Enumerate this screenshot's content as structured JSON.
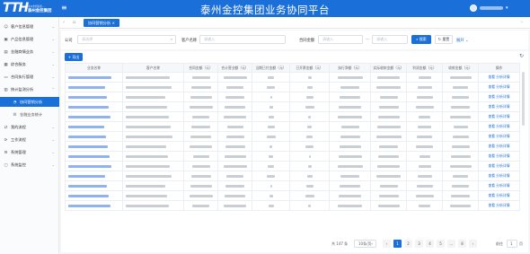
{
  "header": {
    "logo_mark": "TTH",
    "logo_line1": "泰州金控集团 …",
    "logo_line2": "泰州金控集团",
    "menu_icon": "menu-icon",
    "title": "泰州金控集团业务协同平台"
  },
  "sidebar": {
    "items": [
      {
        "label": "客户信息管理",
        "icon": "user-icon",
        "expandable": true
      },
      {
        "label": "产品信息管理",
        "icon": "box-icon",
        "expandable": true
      },
      {
        "label": "金融商情业务",
        "icon": "briefcase-icon",
        "expandable": true
      },
      {
        "label": "综合服务",
        "icon": "grid-icon",
        "expandable": true
      },
      {
        "label": "合同执行管理",
        "icon": "document-icon",
        "expandable": true
      },
      {
        "label": "统计监测分析",
        "icon": "chart-icon",
        "expandable": true
      },
      {
        "label": "协同营销分析",
        "icon": "pie-icon",
        "active": true
      },
      {
        "label": "金融业务统计",
        "icon": "list-icon"
      },
      {
        "label": "我的流程",
        "icon": "flow-icon",
        "expandable": true
      },
      {
        "label": "工作流程",
        "icon": "workflow-icon",
        "expandable": true
      },
      {
        "label": "系统管理",
        "icon": "gear-icon",
        "expandable": true
      },
      {
        "label": "系统监控",
        "icon": "monitor-icon",
        "expandable": true
      }
    ]
  },
  "tabs": {
    "home_icon": "home-icon",
    "active_tab": "协同营销分析"
  },
  "filter": {
    "company_label": "公司",
    "company_placeholder": "请选择",
    "customer_label": "客户名称",
    "customer_placeholder": "请输入",
    "amount_label": "合同金额",
    "amount_min_placeholder": "请输入",
    "amount_max_placeholder": "请输入",
    "search_label": "搜索",
    "reset_label": "重置",
    "expand_label": "展开"
  },
  "toolbar": {
    "export_label": "导出"
  },
  "table": {
    "columns": [
      "业务名称",
      "客户名称",
      "合同金额（元）",
      "合计营业额（元）",
      "当期已付金额（元）",
      "已开票金额（元）",
      "执行净额（元）",
      "实际收款金额（元）",
      "利润金额（元）",
      "收款金额（元）",
      "操作"
    ],
    "rows": [
      {
        "op": "查看  分析详情"
      },
      {
        "op": "查看  分析详情"
      },
      {
        "op": "查看  分析详情"
      },
      {
        "op": "查看  分析详情"
      },
      {
        "op": "查看  分析详情"
      },
      {
        "op": "查看  分析详情"
      },
      {
        "op": "查看  分析详情"
      },
      {
        "op": "查看  分析详情"
      },
      {
        "op": "查看  分析详情"
      },
      {
        "op": "查看  分析详情"
      },
      {
        "op": "查看  分析详情"
      },
      {
        "op": "查看  分析详情"
      },
      {
        "op": "查看  分析详情"
      },
      {
        "op": "查看  分析详情"
      }
    ]
  },
  "pagination": {
    "total": "共 147 条",
    "page_size": "10条/页",
    "pages": [
      "1",
      "2",
      "3",
      "4",
      "5",
      "...",
      "8"
    ],
    "current": "1",
    "goto_label": "前往",
    "goto_value": "1",
    "page_suffix": "页"
  }
}
